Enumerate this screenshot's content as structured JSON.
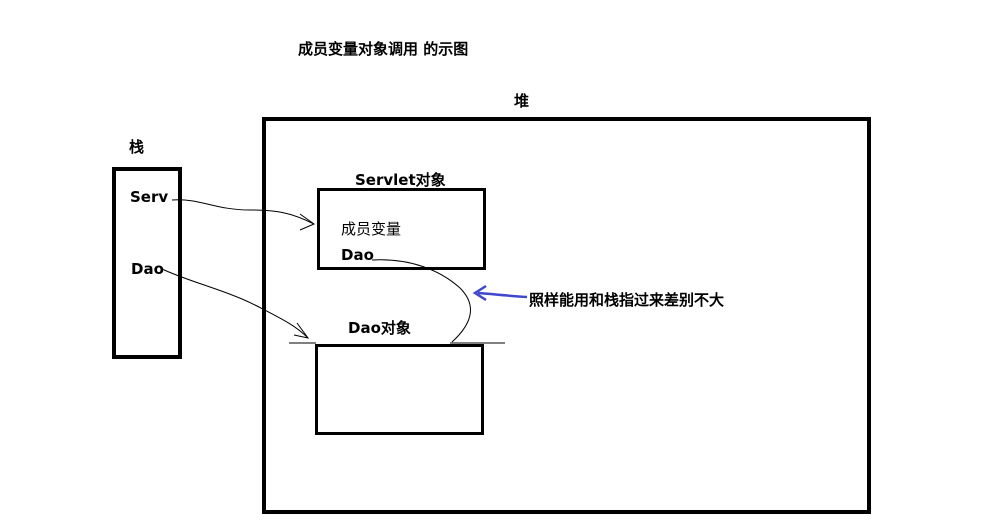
{
  "title": "成员变量对象调用 的示图",
  "heap": {
    "label": "堆"
  },
  "stack": {
    "label": "栈",
    "items": [
      "Serv",
      "Dao"
    ]
  },
  "servlet_object": {
    "label": "Servlet对象",
    "fields": [
      "成员变量",
      "Dao"
    ]
  },
  "dao_object": {
    "label": "Dao对象"
  },
  "annotation": {
    "text": "照样能用和栈指过来差别不大",
    "arrow_color": "#3f48cc"
  }
}
